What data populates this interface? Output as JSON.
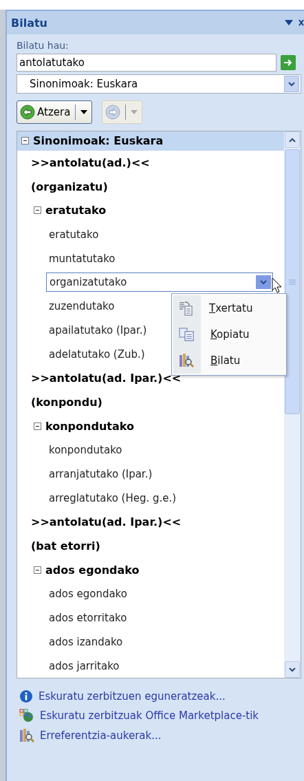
{
  "pane": {
    "title": "Bilatu"
  },
  "search": {
    "label": "Bilatu hau:",
    "value": "antolatutako"
  },
  "source": {
    "value": "Sinonimoak: Euskara"
  },
  "nav": {
    "back_label": "Atzera",
    "forward_disabled": true
  },
  "results": {
    "title": "Sinonimoak: Euskara",
    "expanded": true,
    "entries": [
      {
        "meaning": ">>antolatu(ad.)<<",
        "category": "(organizatu)",
        "groups": [
          {
            "label": "eratutako",
            "expanded": true,
            "words": [
              {
                "text": "eratutako",
                "selected": false
              },
              {
                "text": "muntatutako",
                "selected": false
              },
              {
                "text": "organizatutako",
                "selected": true
              },
              {
                "text": "zuzendutako",
                "selected": false
              },
              {
                "text": "apailatutako (Ipar.)",
                "selected": false
              },
              {
                "text": "adelatutako (Zub.)",
                "selected": false
              }
            ]
          }
        ]
      },
      {
        "meaning": ">>antolatu(ad. Ipar.)<<",
        "category": "(konpondu)",
        "groups": [
          {
            "label": "konpondutako",
            "expanded": true,
            "words": [
              {
                "text": "konpondutako",
                "selected": false
              },
              {
                "text": "arranjatutako (Ipar.)",
                "selected": false
              },
              {
                "text": "arreglatutako (Heg. g.e.)",
                "selected": false
              }
            ]
          }
        ]
      },
      {
        "meaning": ">>antolatu(ad. Ipar.)<<",
        "category": "(bat etorri)",
        "groups": [
          {
            "label": "ados egondako",
            "expanded": true,
            "words": [
              {
                "text": "ados egondako",
                "selected": false
              },
              {
                "text": "ados etorritako",
                "selected": false
              },
              {
                "text": "ados izandako",
                "selected": false
              },
              {
                "text": "ados jarritako",
                "selected": false
              }
            ]
          }
        ]
      }
    ]
  },
  "context_menu": {
    "items": [
      {
        "kind": "insert",
        "label": "Txertatu"
      },
      {
        "kind": "copy",
        "label": "Kopiatu"
      },
      {
        "kind": "lookup",
        "label": "Bilatu"
      }
    ]
  },
  "footer_links": [
    {
      "kind": "info",
      "label": "Eskuratu zerbitzuen eguneratzeak..."
    },
    {
      "kind": "marketplace",
      "label": "Eskuratu zerbitzuak Office Marketplace-tik"
    },
    {
      "kind": "options",
      "label": "Erreferentzia-aukerak..."
    }
  ]
}
